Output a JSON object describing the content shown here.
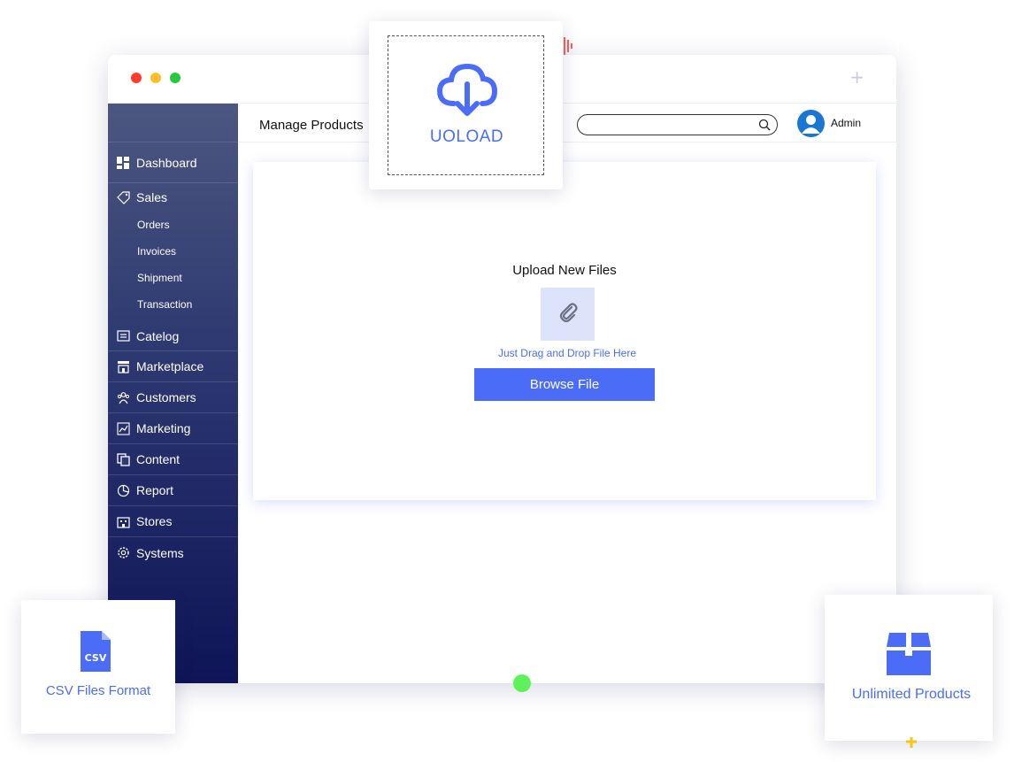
{
  "window": {
    "page_title": "Manage Products",
    "admin_label": "Admin"
  },
  "sidebar": {
    "items": [
      {
        "label": "Dashboard",
        "icon": "dashboard-icon"
      },
      {
        "label": "Sales",
        "icon": "tag-icon",
        "children": [
          "Orders",
          "Invoices",
          "Shipment",
          "Transaction"
        ]
      },
      {
        "label": "Catelog",
        "icon": "catalog-icon"
      },
      {
        "label": "Marketplace",
        "icon": "store-icon"
      },
      {
        "label": "Customers",
        "icon": "customers-icon"
      },
      {
        "label": "Marketing",
        "icon": "marketing-icon"
      },
      {
        "label": "Content",
        "icon": "copy-icon"
      },
      {
        "label": "Report",
        "icon": "report-icon"
      },
      {
        "label": "Stores",
        "icon": "building-icon"
      },
      {
        "label": "Systems",
        "icon": "gear-icon"
      }
    ]
  },
  "upload_panel": {
    "title": "Upload New Files",
    "drop_text": "Just Drag and Drop File Here",
    "browse_label": "Browse File",
    "icon": "paperclip-icon"
  },
  "floating": {
    "upload_label": "UOLOAD",
    "upload_icon": "cloud-download-icon",
    "csv_label": "CSV Files Format",
    "csv_icon": "csv-file-icon",
    "csv_icon_text": "CSV",
    "unlimited_label": "Unlimited Products",
    "unlimited_icon": "box-icon"
  },
  "colors": {
    "accent": "#4a6cf7",
    "sidebar_top": "#4c5780",
    "sidebar_bottom": "#0e1457"
  }
}
